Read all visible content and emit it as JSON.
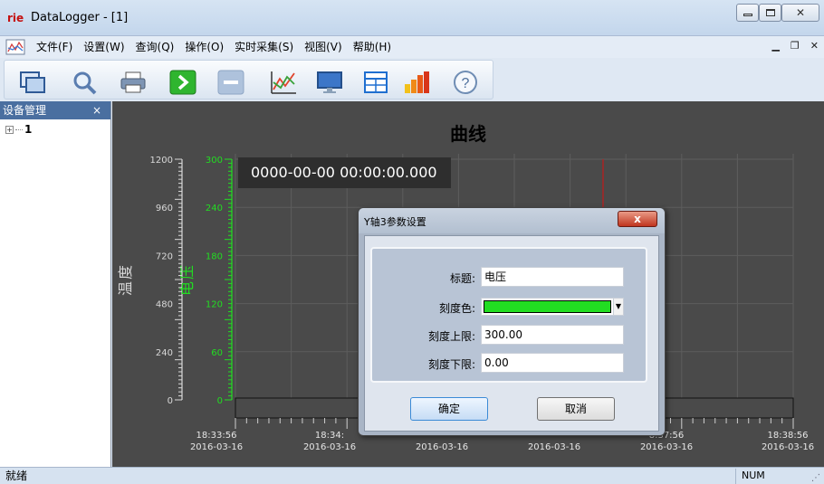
{
  "window": {
    "logo": "rie",
    "title": "DataLogger - [1]"
  },
  "menu": [
    "文件(F)",
    "设置(W)",
    "查询(Q)",
    "操作(O)",
    "实时采集(S)",
    "视图(V)",
    "帮助(H)"
  ],
  "toolbar_icons": [
    "window-icon",
    "search-icon",
    "print-icon",
    "play-icon",
    "stop-icon",
    "chart-icon",
    "monitor-icon",
    "table-icon",
    "bar-chart-icon",
    "help-icon"
  ],
  "panel": {
    "title": "设备管理",
    "close": "×",
    "tree_item": "1",
    "expand": "+"
  },
  "chart": {
    "title": "曲线",
    "time_display": "0000-00-00 00:00:00.000",
    "axis1_label": "温度",
    "axis2_label": "电压",
    "axis2_color": "#22dd22",
    "x_tick_times": [
      "18:33:56",
      "18:34:",
      "",
      "",
      "8:37:56",
      "18:38:56"
    ],
    "x_tick_dates": [
      "2016-03-16",
      "2016-03-16",
      "2016-03-16",
      "2016-03-16",
      "2016-03-16",
      "2016-03-16"
    ]
  },
  "chart_data": {
    "type": "line",
    "title": "曲线",
    "y_axes": [
      {
        "label": "温度",
        "ticks": [
          0,
          240,
          480,
          720,
          960,
          1200
        ],
        "ylim": [
          0,
          1200
        ]
      },
      {
        "label": "电压",
        "ticks": [
          0,
          60,
          120,
          180,
          240,
          300
        ],
        "ylim": [
          0,
          300
        ],
        "color": "#22dd22"
      }
    ],
    "x_time_labels": [
      "18:33:56",
      "18:34:",
      "",
      "",
      "8:37:56",
      "18:38:56"
    ],
    "x_date_labels": [
      "2016-03-16",
      "2016-03-16",
      "2016-03-16",
      "2016-03-16",
      "2016-03-16",
      "2016-03-16"
    ],
    "series": [],
    "grid": true
  },
  "dialog": {
    "title": "Y轴3参数设置",
    "close": "x",
    "fields": [
      {
        "label": "标题:",
        "value": "电压"
      },
      {
        "label": "刻度色:",
        "value": "#22dd22"
      },
      {
        "label": "刻度上限:",
        "value": "300.00"
      },
      {
        "label": "刻度下限:",
        "value": "0.00"
      }
    ],
    "ok": "确定",
    "cancel": "取消"
  },
  "status": {
    "text": "就绪",
    "num": "NUM"
  }
}
